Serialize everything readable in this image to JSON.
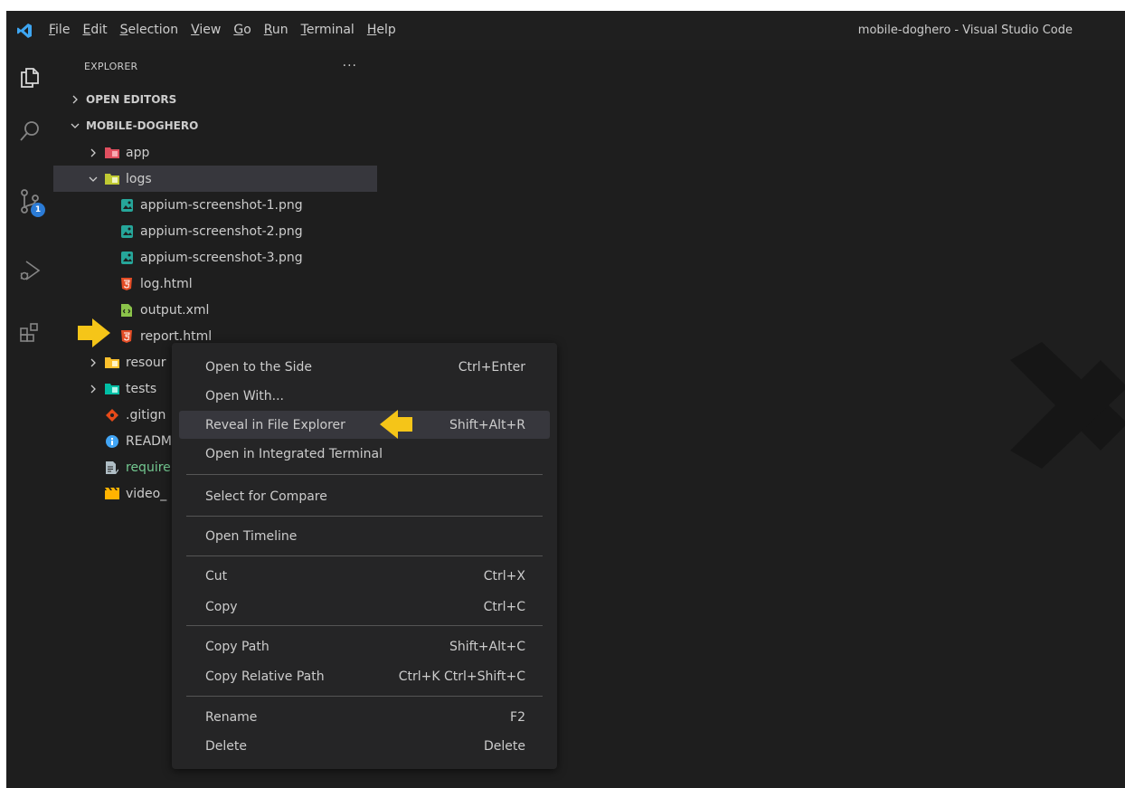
{
  "window": {
    "title": "mobile-doghero - Visual Studio Code"
  },
  "menubar": [
    {
      "mnemonic": "F",
      "rest": "ile"
    },
    {
      "mnemonic": "E",
      "rest": "dit"
    },
    {
      "mnemonic": "S",
      "rest": "election"
    },
    {
      "mnemonic": "V",
      "rest": "iew"
    },
    {
      "mnemonic": "G",
      "rest": "o"
    },
    {
      "mnemonic": "R",
      "rest": "un"
    },
    {
      "mnemonic": "T",
      "rest": "erminal"
    },
    {
      "mnemonic": "H",
      "rest": "elp"
    }
  ],
  "activity": {
    "icons": [
      "explorer-icon",
      "search-icon",
      "source-control-icon",
      "run-debug-icon",
      "extensions-icon"
    ],
    "scm_badge": "1"
  },
  "sidebar": {
    "title": "EXPLORER",
    "more": "···",
    "open_editors": "OPEN EDITORS",
    "project": "MOBILE-DOGHERO",
    "tree": [
      {
        "label": "app",
        "icon": "folder-app-icon"
      },
      {
        "label": "logs",
        "icon": "folder-logs-icon"
      },
      {
        "label": "appium-screenshot-1.png",
        "icon": "image-file-icon"
      },
      {
        "label": "appium-screenshot-2.png",
        "icon": "image-file-icon"
      },
      {
        "label": "appium-screenshot-3.png",
        "icon": "image-file-icon"
      },
      {
        "label": "log.html",
        "icon": "html-file-icon"
      },
      {
        "label": "output.xml",
        "icon": "xml-file-icon"
      },
      {
        "label": "report.html",
        "icon": "html-file-icon"
      },
      {
        "label": "resour",
        "icon": "folder-resources-icon"
      },
      {
        "label": "tests",
        "icon": "folder-tests-icon"
      },
      {
        "label": ".gitign",
        "icon": "git-file-icon"
      },
      {
        "label": "READM",
        "icon": "info-file-icon"
      },
      {
        "label": "require",
        "icon": "requirements-file-icon"
      },
      {
        "label": "video_",
        "icon": "video-file-icon"
      }
    ]
  },
  "context_menu": {
    "items": [
      {
        "label": "Open to the Side",
        "shortcut": "Ctrl+Enter"
      },
      {
        "label": "Open With...",
        "shortcut": ""
      },
      {
        "label": "Reveal in File Explorer",
        "shortcut": "Shift+Alt+R"
      },
      {
        "label": "Open in Integrated Terminal",
        "shortcut": ""
      },
      {
        "label": "Select for Compare",
        "shortcut": ""
      },
      {
        "label": "Open Timeline",
        "shortcut": ""
      },
      {
        "label": "Cut",
        "shortcut": "Ctrl+X"
      },
      {
        "label": "Copy",
        "shortcut": "Ctrl+C"
      },
      {
        "label": "Copy Path",
        "shortcut": "Shift+Alt+C"
      },
      {
        "label": "Copy Relative Path",
        "shortcut": "Ctrl+K Ctrl+Shift+C"
      },
      {
        "label": "Rename",
        "shortcut": "F2"
      },
      {
        "label": "Delete",
        "shortcut": "Delete"
      }
    ]
  },
  "colors": {
    "accent": "#007acc",
    "annotation_arrow": "#f5c518",
    "selection": "#37373d",
    "menu_bg": "#252526"
  }
}
